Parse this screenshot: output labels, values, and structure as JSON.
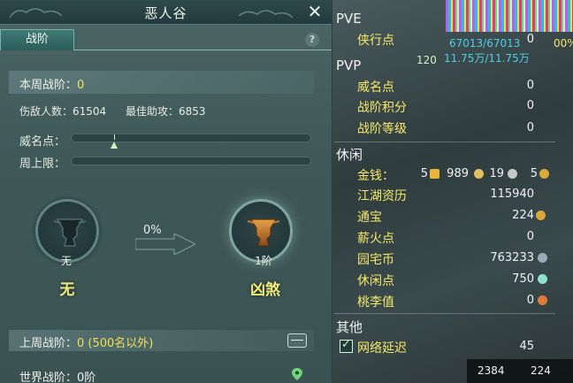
{
  "window": {
    "title": "恶人谷"
  },
  "tabs": [
    {
      "label": "战阶"
    }
  ],
  "help_label": "?",
  "week": {
    "label": "本周战阶：",
    "value": "0"
  },
  "stats": {
    "kills": "伤敌人数：61504",
    "assists": "最佳助攻：6853"
  },
  "prestige": {
    "label": "威名点：",
    "progress": 0.18
  },
  "cap": {
    "label": "周上限：",
    "progress": 0
  },
  "current_rank": {
    "sub": "无",
    "name": "无"
  },
  "next_rank": {
    "sub": "1阶",
    "name": "凶煞"
  },
  "progress_pct": "0%",
  "last_week": {
    "label": "上周战阶：",
    "value": "0 (500名以外)"
  },
  "world": {
    "label": "世界战阶：",
    "value": "0阶"
  },
  "hud": {
    "pve_head": "PVE",
    "pve_items": [
      {
        "label": "侠行点",
        "value": "0"
      }
    ],
    "hp_text": "67013/67013",
    "mp_text": "11.75万/11.75万",
    "level": "120",
    "pct_text": "00%",
    "pvp_head": "PVP",
    "pvp_items": [
      {
        "label": "威名点",
        "value": "0"
      },
      {
        "label": "战阶积分",
        "value": "0"
      },
      {
        "label": "战阶等级",
        "value": "0"
      }
    ],
    "leisure_head": "休闲",
    "money": {
      "label": "金钱：",
      "gold": "5",
      "silver": "989",
      "copper": "19",
      "extra": "5"
    },
    "leisure_items": [
      {
        "label": "江湖资历",
        "value": "115940"
      },
      {
        "label": "通宝",
        "value": "224"
      },
      {
        "label": "薪火点",
        "value": "0"
      },
      {
        "label": "园宅币",
        "value": "763233"
      },
      {
        "label": "休闲点",
        "value": "750"
      },
      {
        "label": "桃李值",
        "value": "0"
      }
    ],
    "other_head": "其他",
    "latency": {
      "label": "网络延迟",
      "value": "45"
    },
    "bottom": {
      "left": "2384",
      "right": "224"
    }
  }
}
